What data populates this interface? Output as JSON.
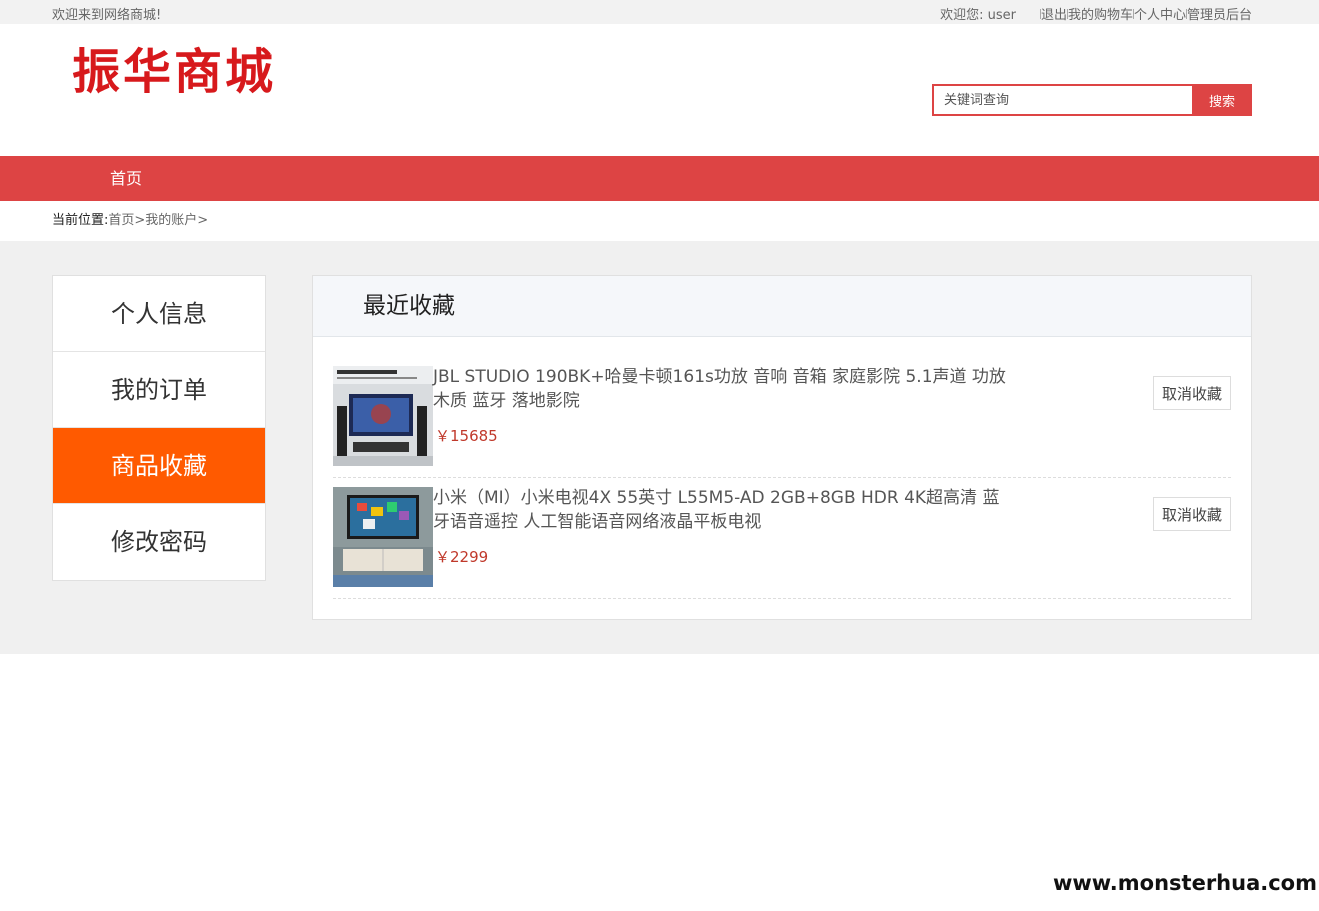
{
  "topbar": {
    "welcome": "欢迎来到网络商城!",
    "user_greeting": "欢迎您:  user",
    "logout": "退出",
    "cart": "我的购物车",
    "profile": "个人中心",
    "admin": "管理员后台"
  },
  "header": {
    "logo": "振华商城",
    "search_placeholder": "关键词查询",
    "search_button": "搜索"
  },
  "nav": {
    "home": "首页"
  },
  "breadcrumb": {
    "label": "当前位置:",
    "path": "首页>我的账户>"
  },
  "sidebar": {
    "items": [
      {
        "label": "个人信息"
      },
      {
        "label": "我的订单"
      },
      {
        "label": "商品收藏"
      },
      {
        "label": "修改密码"
      }
    ]
  },
  "favorites": {
    "title": "最近收藏",
    "cancel_label": "取消收藏",
    "items": [
      {
        "name": "JBL STUDIO 190BK+哈曼卡顿161s功放 音响 音箱 家庭影院 5.1声道 功放 木质 蓝牙 落地影院",
        "price": "￥15685"
      },
      {
        "name": "小米（MI）小米电视4X 55英寸 L55M5-AD 2GB+8GB HDR 4K超高清 蓝牙语音遥控 人工智能语音网络液晶平板电视",
        "price": "￥2299"
      }
    ]
  },
  "watermark": "www.monsterhua.com",
  "colors": {
    "brand_red": "#dd4444",
    "active_orange": "#ff5a00",
    "price_red": "#c0392b"
  }
}
